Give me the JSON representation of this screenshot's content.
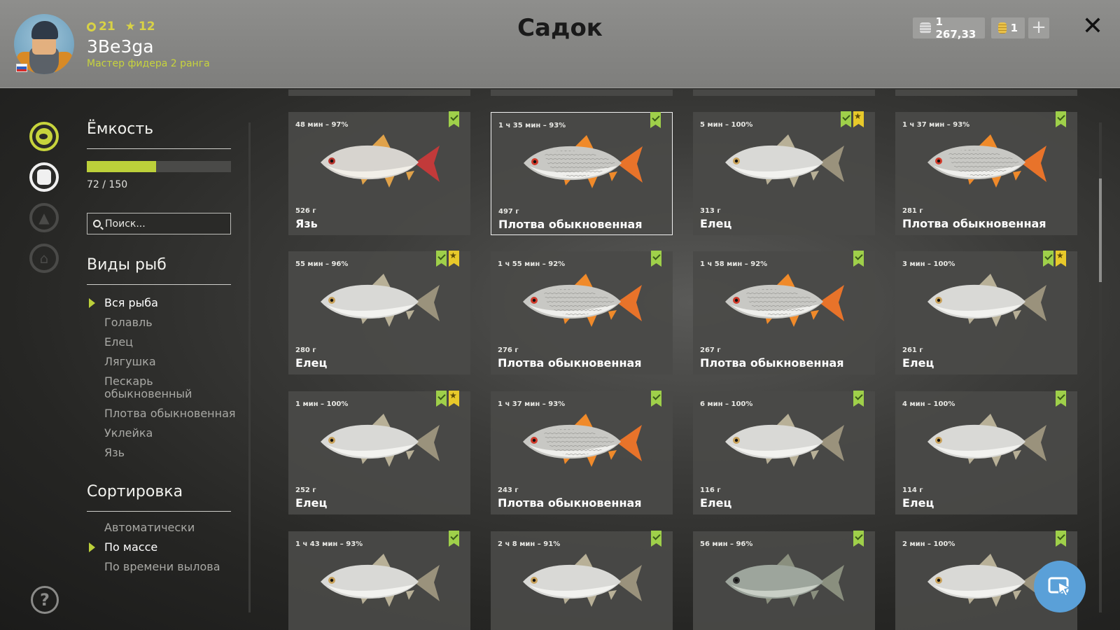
{
  "header": {
    "title": "Садок",
    "player": {
      "level": "21",
      "stars": "12",
      "name": "3Be3ga",
      "rank": "Мастер фидера 2 ранга"
    },
    "currency": {
      "silver": "1 267,33",
      "gold": "1",
      "add_label": "+"
    },
    "close_label": "✕"
  },
  "nav": {
    "icons": [
      "keepnet-icon",
      "backpack-icon",
      "tent-icon",
      "home-icon"
    ],
    "help_label": "?"
  },
  "capacity": {
    "title": "Ёмкость",
    "current": 72,
    "max": 150,
    "text": "72 / 150"
  },
  "search": {
    "placeholder": "Поиск..."
  },
  "species": {
    "title": "Виды рыб",
    "items": [
      {
        "label": "Вся рыба",
        "active": true
      },
      {
        "label": "Голавль",
        "active": false
      },
      {
        "label": "Елец",
        "active": false
      },
      {
        "label": "Лягушка",
        "active": false
      },
      {
        "label": "Пескарь обыкновенный",
        "active": false
      },
      {
        "label": "Плотва обыкновенная",
        "active": false
      },
      {
        "label": "Уклейка",
        "active": false
      },
      {
        "label": "Язь",
        "active": false
      }
    ]
  },
  "sorting": {
    "title": "Сортировка",
    "items": [
      {
        "label": "Автоматически",
        "active": false
      },
      {
        "label": "По массе",
        "active": true
      },
      {
        "label": "По времени вылова",
        "active": false
      }
    ]
  },
  "colors": {
    "accent": "#c7d43c",
    "bookmark_green": "#9fd04a",
    "bookmark_yellow": "#e8c92a",
    "action_blue": "#5aa0d8"
  },
  "fish": [
    {
      "time": "48 мин – 97%",
      "weight": "526 г",
      "name": "Язь",
      "starred": false,
      "selected": false,
      "kind": "ide"
    },
    {
      "time": "1 ч 35 мин – 93%",
      "weight": "497 г",
      "name": "Плотва обыкновенная",
      "starred": false,
      "selected": true,
      "kind": "roach"
    },
    {
      "time": "5 мин – 100%",
      "weight": "313 г",
      "name": "Елец",
      "starred": true,
      "selected": false,
      "kind": "dace"
    },
    {
      "time": "1 ч 37 мин – 93%",
      "weight": "281 г",
      "name": "Плотва обыкновенная",
      "starred": false,
      "selected": false,
      "kind": "roach"
    },
    {
      "time": "55 мин – 96%",
      "weight": "280 г",
      "name": "Елец",
      "starred": true,
      "selected": false,
      "kind": "dace"
    },
    {
      "time": "1 ч 55 мин – 92%",
      "weight": "276 г",
      "name": "Плотва обыкновенная",
      "starred": false,
      "selected": false,
      "kind": "roach"
    },
    {
      "time": "1 ч 58 мин – 92%",
      "weight": "267 г",
      "name": "Плотва обыкновенная",
      "starred": false,
      "selected": false,
      "kind": "roach"
    },
    {
      "time": "3 мин – 100%",
      "weight": "261 г",
      "name": "Елец",
      "starred": true,
      "selected": false,
      "kind": "dace"
    },
    {
      "time": "1 мин – 100%",
      "weight": "252 г",
      "name": "Елец",
      "starred": true,
      "selected": false,
      "kind": "dace"
    },
    {
      "time": "1 ч 37 мин – 93%",
      "weight": "243 г",
      "name": "Плотва обыкновенная",
      "starred": false,
      "selected": false,
      "kind": "roach"
    },
    {
      "time": "6 мин – 100%",
      "weight": "116 г",
      "name": "Елец",
      "starred": false,
      "selected": false,
      "kind": "dace"
    },
    {
      "time": "4 мин – 100%",
      "weight": "114 г",
      "name": "Елец",
      "starred": false,
      "selected": false,
      "kind": "dace"
    },
    {
      "time": "1 ч 43 мин – 93%",
      "weight": "",
      "name": "",
      "starred": false,
      "selected": false,
      "kind": "dace"
    },
    {
      "time": "2 ч 8 мин – 91%",
      "weight": "",
      "name": "",
      "starred": false,
      "selected": false,
      "kind": "dace"
    },
    {
      "time": "56 мин – 96%",
      "weight": "",
      "name": "",
      "starred": false,
      "selected": false,
      "kind": "bleak"
    },
    {
      "time": "2 мин – 100%",
      "weight": "",
      "name": "",
      "starred": false,
      "selected": false,
      "kind": "dace"
    }
  ]
}
